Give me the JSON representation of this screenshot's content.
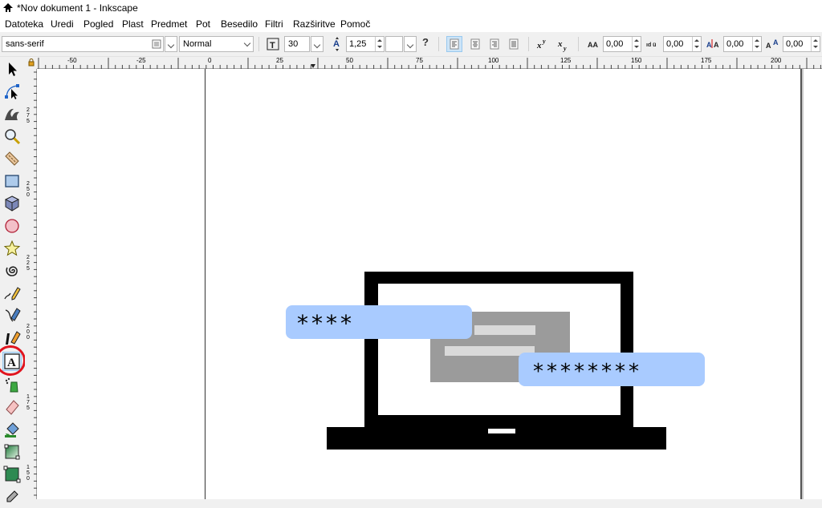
{
  "window": {
    "title": "*Nov dokument 1 - Inkscape"
  },
  "menu": [
    "Datoteka",
    "Uredi",
    "Pogled",
    "Plast",
    "Predmet",
    "Pot",
    "Besedilo",
    "Filtri",
    "Razširitve",
    "Pomoč"
  ],
  "text_toolbar": {
    "font_family": "sans-serif",
    "font_style": "Normal",
    "font_size": "30",
    "line_spacing": "1,25",
    "letter_spacing": "0,00",
    "word_spacing": "0,00",
    "horizontal_kerning": "0,00",
    "vertical_shift": "0,00",
    "help_glyph": "?"
  },
  "ruler_top_labels": [
    "-50",
    "-25",
    "0",
    "25",
    "50",
    "75",
    "100",
    "125",
    "150",
    "175",
    "200"
  ],
  "ruler_left_labels": [
    "275",
    "250",
    "225",
    "200",
    "175",
    "150"
  ],
  "canvas": {
    "password_short": "****",
    "password_long": "********"
  },
  "colors": {
    "field_fill": "#a9cbff",
    "highlight_circle": "#e0141e",
    "laptop": "#000000",
    "screen_card": "#9b9b9b"
  }
}
